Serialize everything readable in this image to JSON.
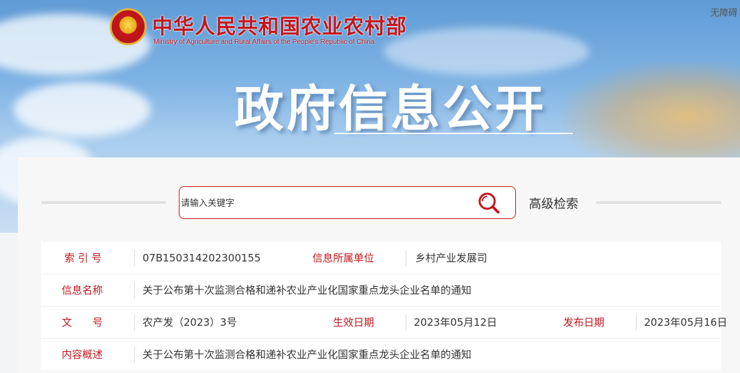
{
  "header": {
    "org_name_cn": "中华人民共和国农业农村部",
    "org_name_en": "Ministry of Agriculture and Rural Affairs of the People's Republic of China",
    "accessibility_label": "无障碍",
    "page_title": "政府信息公开"
  },
  "search": {
    "placeholder": "请输入关键字",
    "advanced_label": "高级检索"
  },
  "info": {
    "index_label": "索 引 号",
    "index_value": "07B150314202300155",
    "unit_label": "信息所属单位",
    "unit_value": "乡村产业发展司",
    "name_label": "信息名称",
    "name_value": "关于公布第十次监测合格和递补农业产业化国家重点龙头企业名单的通知",
    "doc_no_label": "文　　号",
    "doc_no_value": "农产发（2023）3号",
    "effective_label": "生效日期",
    "effective_value": "2023年05月12日",
    "publish_label": "发布日期",
    "publish_value": "2023年05月16日",
    "summary_label": "内容概述",
    "summary_value": "关于公布第十次监测合格和递补农业产业化国家重点龙头企业名单的通知"
  },
  "colors": {
    "accent_red": "#c4161c",
    "banner_blue": "#7fb3e4"
  }
}
